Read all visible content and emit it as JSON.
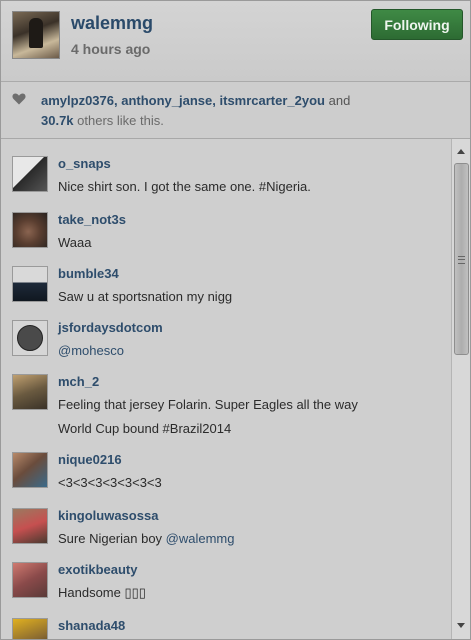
{
  "post": {
    "username": "walemmg",
    "timestamp": "4 hours ago",
    "follow_label": "Following"
  },
  "likes": {
    "icon": "heart-icon",
    "users": [
      "amylpz0376",
      "anthony_janse",
      "itsmrcarter_2you"
    ],
    "separator": ", ",
    "and_text": " and",
    "count": "30.7k",
    "suffix": " others like this."
  },
  "comments": [
    {
      "user": "o_snaps",
      "lines": [
        "Nice shirt son. I got the same one. #Nigeria."
      ]
    },
    {
      "user": "take_not3s",
      "lines": [
        "Waaa"
      ]
    },
    {
      "user": "bumble34",
      "lines": [
        "Saw u at sportsnation my nigg"
      ]
    },
    {
      "user": "jsfordaysdotcom",
      "mention": "@mohesco",
      "lines": []
    },
    {
      "user": "mch_2",
      "lines": [
        "Feeling that jersey Folarin. Super Eagles all the way",
        "World Cup bound #Brazil2014"
      ]
    },
    {
      "user": "nique0216",
      "lines": [
        "<3<3<3<3<3<3<3"
      ]
    },
    {
      "user": "kingoluwasossa",
      "text_prefix": "Sure Nigerian boy ",
      "mention": "@walemmg",
      "lines": []
    },
    {
      "user": "exotikbeauty",
      "lines": [
        "Handsome ▯▯▯"
      ]
    },
    {
      "user": "shanada48",
      "lines": []
    }
  ],
  "colors": {
    "link": "#2e4d6c",
    "button": "#3a7f40",
    "background": "#cfcfcf"
  }
}
